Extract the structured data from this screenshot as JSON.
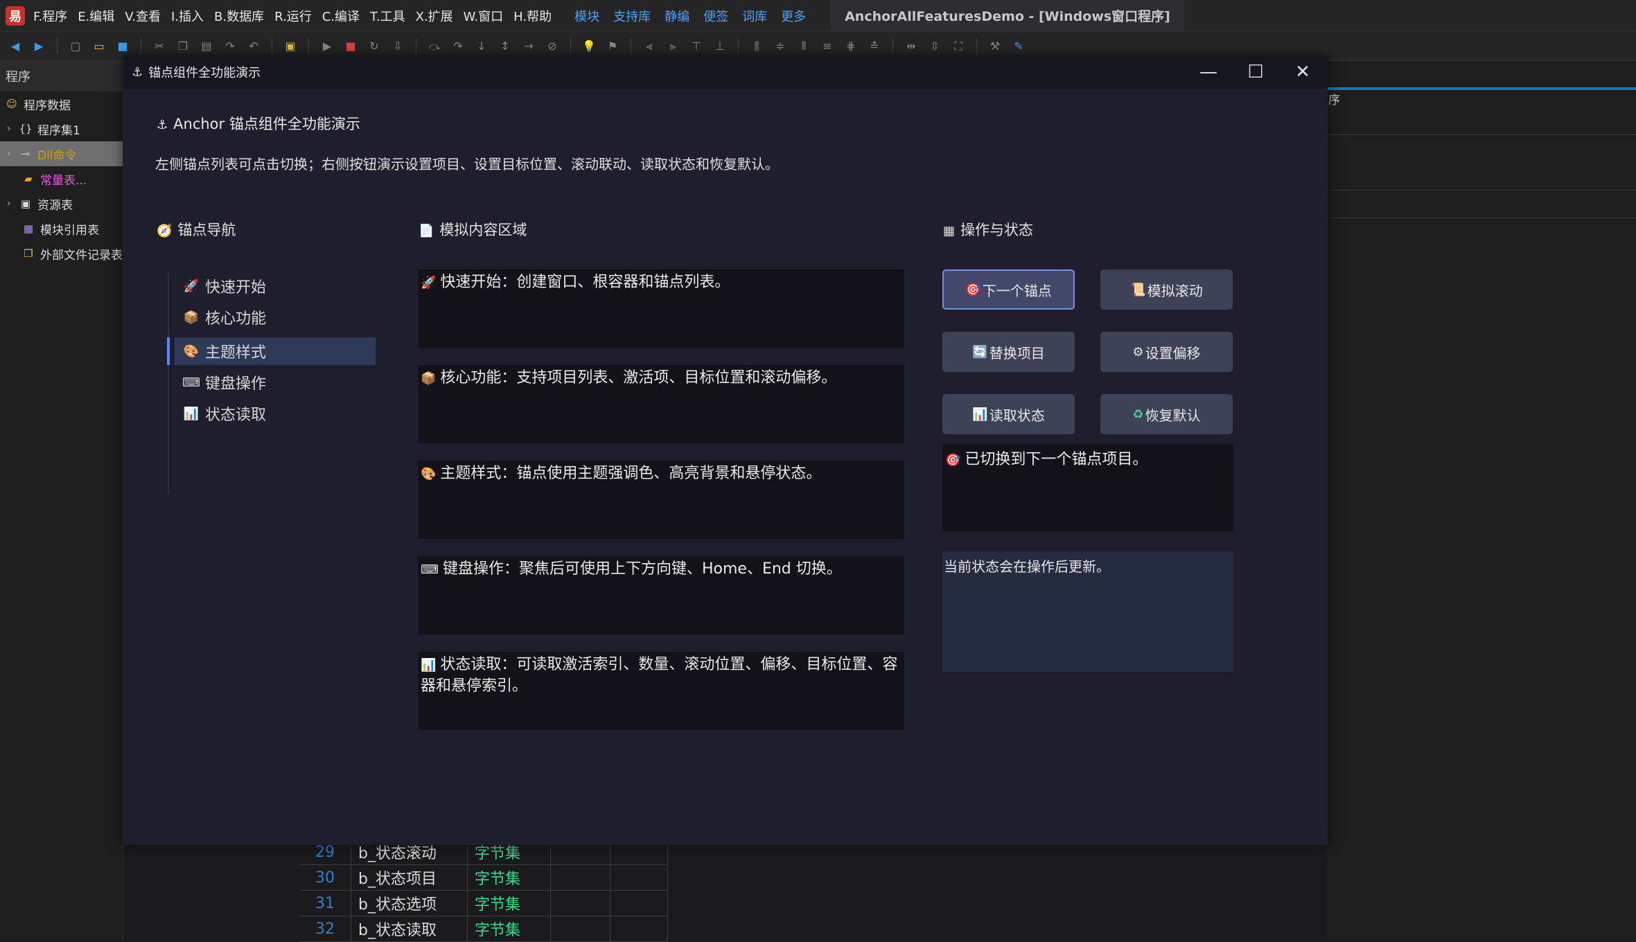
{
  "ide": {
    "logo": "易",
    "menu": [
      "F.程序",
      "E.编辑",
      "V.查看",
      "I.插入",
      "B.数据库",
      "R.运行",
      "C.编译",
      "T.工具",
      "X.扩展",
      "W.窗口",
      "H.帮助"
    ],
    "links": [
      "模块",
      "支持库",
      "静编",
      "便签",
      "词库",
      "更多"
    ],
    "window_title": "AnchorAllFeaturesDemo - [Windows窗口程序]",
    "sidebar": {
      "header": "程序",
      "items": [
        {
          "label": "程序数据",
          "icon": "smiley-icon"
        },
        {
          "label": "程序集1",
          "icon": "braces-icon"
        },
        {
          "label": "Dll命令",
          "icon": "dll-icon"
        },
        {
          "label": "常量表...",
          "icon": "constant-icon"
        },
        {
          "label": "资源表",
          "icon": "resource-icon"
        },
        {
          "label": "模块引用表",
          "icon": "module-icon"
        },
        {
          "label": "外部文件记录表",
          "icon": "file-record-icon"
        }
      ]
    },
    "editor_tab_text": "序",
    "code_rows": [
      {
        "line": "29",
        "name": "b_状态滚动",
        "type": "字节集"
      },
      {
        "line": "30",
        "name": "b_状态项目",
        "type": "字节集"
      },
      {
        "line": "31",
        "name": "b_状态选项",
        "type": "字节集"
      },
      {
        "line": "32",
        "name": "b_状态读取",
        "type": "字节集"
      }
    ]
  },
  "dialog": {
    "title": "锚点组件全功能演示",
    "heading": "Anchor 锚点组件全功能演示",
    "description": "左侧锚点列表可点击切换；右侧按钮演示设置项目、设置目标位置、滚动联动、读取状态和恢复默认。",
    "sections": {
      "nav": "锚点导航",
      "content": "模拟内容区域",
      "ops": "操作与状态"
    },
    "nav_items": [
      {
        "label": "快速开始",
        "icon": "🚀"
      },
      {
        "label": "核心功能",
        "icon": "📦"
      },
      {
        "label": "主题样式",
        "icon": "🎨"
      },
      {
        "label": "键盘操作",
        "icon": "⌨"
      },
      {
        "label": "状态读取",
        "icon": "📊"
      }
    ],
    "cards": [
      {
        "icon": "🚀",
        "text": "快速开始：创建窗口、根容器和锚点列表。"
      },
      {
        "icon": "📦",
        "text": "核心功能：支持项目列表、激活项、目标位置和滚动偏移。"
      },
      {
        "icon": "🎨",
        "text": "主题样式：锚点使用主题强调色、高亮背景和悬停状态。"
      },
      {
        "icon": "⌨",
        "text": "键盘操作：聚焦后可使用上下方向键、Home、End 切换。"
      },
      {
        "icon": "📊",
        "text": "状态读取：可读取激活索引、数量、滚动位置、偏移、目标位置、容器和悬停索引。"
      }
    ],
    "buttons": [
      {
        "icon": "🎯",
        "label": "下一个锚点"
      },
      {
        "icon": "📜",
        "label": "模拟滚动"
      },
      {
        "icon": "🔄",
        "label": "替换项目"
      },
      {
        "icon": "⚙",
        "label": "设置偏移"
      },
      {
        "icon": "📊",
        "label": "读取状态"
      },
      {
        "icon": "♻",
        "label": "恢复默认"
      }
    ],
    "status_message": {
      "icon": "🎯",
      "text": "已切换到下一个锚点项目。"
    },
    "state_text": "当前状态会在操作后更新。",
    "active_nav_index": 2
  },
  "colors": {
    "accent": "#4d8cff",
    "active_bg": "#2e3a57",
    "button_bg": "#3d4256",
    "dialog_bg": "#1e1e2e",
    "card_bg": "#121218",
    "link": "#4aa3ff",
    "type_green": "#3dd68c"
  }
}
